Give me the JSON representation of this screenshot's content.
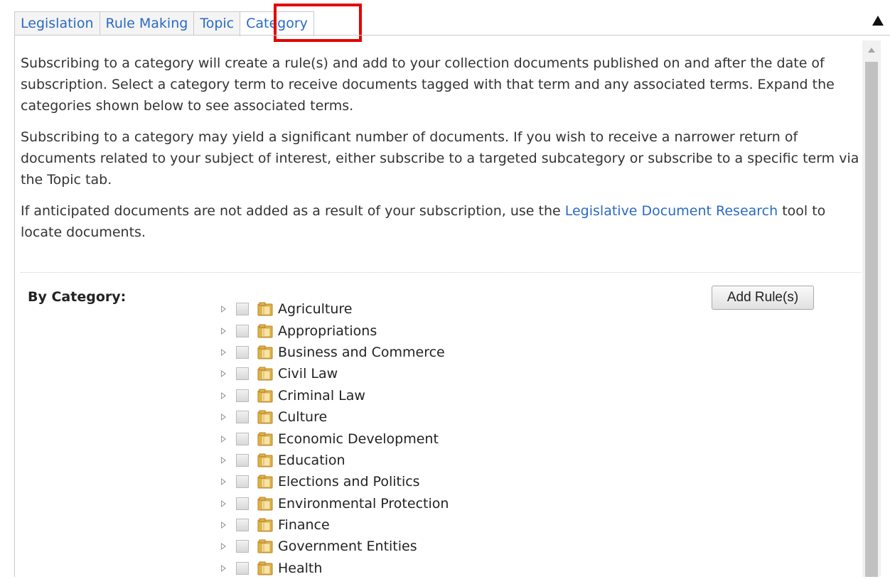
{
  "tabs": [
    {
      "label": "Legislation"
    },
    {
      "label": "Rule Making"
    },
    {
      "label": "Topic"
    },
    {
      "label": "Category"
    }
  ],
  "active_tab": "Category",
  "intro": {
    "p1": "Subscribing to a category will create a rule(s) and add to your collection documents published on and after the date of subscription. Select a category term to receive documents tagged with that term and any associated terms. Expand the categories shown below to see associated terms.",
    "p2": "Subscribing to a category may yield a significant number of documents. If you wish to receive a narrower return of documents related to your subject of interest, either subscribe to a targeted subcategory or subscribe to a specific term via the Topic tab.",
    "p3_before": "If anticipated documents are not added as a result of your subscription, use the ",
    "p3_link": "Legislative Document Research",
    "p3_after": " tool to locate documents."
  },
  "by_category_label": "By Category:",
  "add_rules_label": "Add Rule(s)",
  "categories": [
    {
      "label": "Agriculture"
    },
    {
      "label": "Appropriations"
    },
    {
      "label": "Business and Commerce"
    },
    {
      "label": "Civil Law"
    },
    {
      "label": "Criminal Law"
    },
    {
      "label": "Culture"
    },
    {
      "label": "Economic Development"
    },
    {
      "label": "Education"
    },
    {
      "label": "Elections and Politics"
    },
    {
      "label": "Environmental Protection"
    },
    {
      "label": "Finance"
    },
    {
      "label": "Government Entities"
    },
    {
      "label": "Health"
    }
  ],
  "icons": {
    "expander": "triangle-right-icon",
    "folder": "folder-icon",
    "collapse": "triangle-up-icon"
  },
  "colors": {
    "link": "#2a6ac2",
    "highlight": "#e30000"
  }
}
